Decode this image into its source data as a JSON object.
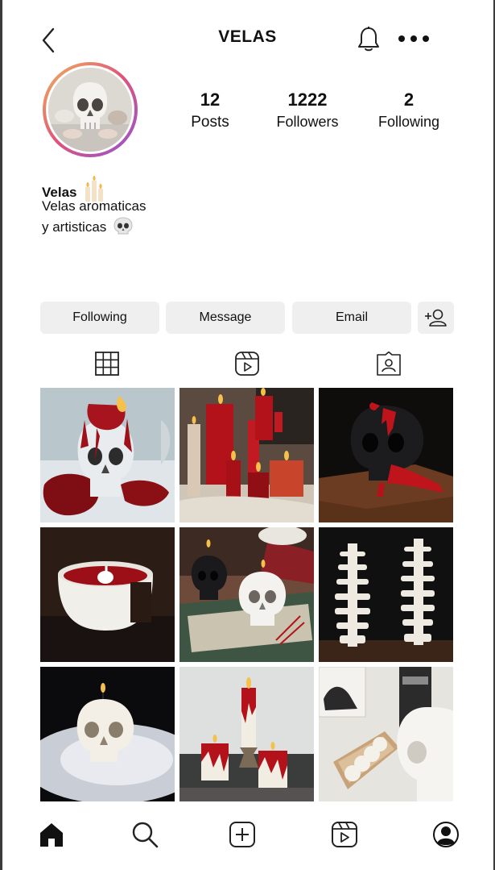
{
  "header": {
    "title": "VELAS",
    "icons": {
      "back": "chevron-left-icon",
      "notifications": "bell-icon",
      "more": "more-horizontal-icon"
    }
  },
  "profile": {
    "name": "Velas",
    "bio_line1": "Velas aromaticas",
    "bio_line2": "y artisticas",
    "name_emoji": "candle-emoji",
    "bio_emoji": "skull-emoji",
    "avatar_colors": [
      "#f0b45a",
      "#e0527a",
      "#8f55d8"
    ]
  },
  "stats": [
    {
      "value": "12",
      "label": "Posts"
    },
    {
      "value": "1222",
      "label": "Followers"
    },
    {
      "value": "2",
      "label": "Following"
    }
  ],
  "actions": {
    "following": "Following",
    "message": "Message",
    "email": "Email",
    "add_friend_icon": "add-user-icon"
  },
  "tabs": [
    "grid-icon",
    "reels-icon",
    "tagged-icon"
  ],
  "posts": [
    "red-candle-melting-on-skull",
    "dripping-red-candles",
    "black-skull-candle-red-wax",
    "red-candle-in-white-bowl",
    "skull-candles-on-books",
    "spine-candles",
    "white-skull-candle",
    "red-wax-candles-on-moss",
    "skull-candles-gift-box"
  ],
  "bottom_nav": [
    "home-icon",
    "search-icon",
    "new-post-icon",
    "reels-icon",
    "profile-icon"
  ],
  "colors": {
    "button_bg": "#efefef",
    "text": "#111111",
    "wax_red": "#b3121a"
  }
}
